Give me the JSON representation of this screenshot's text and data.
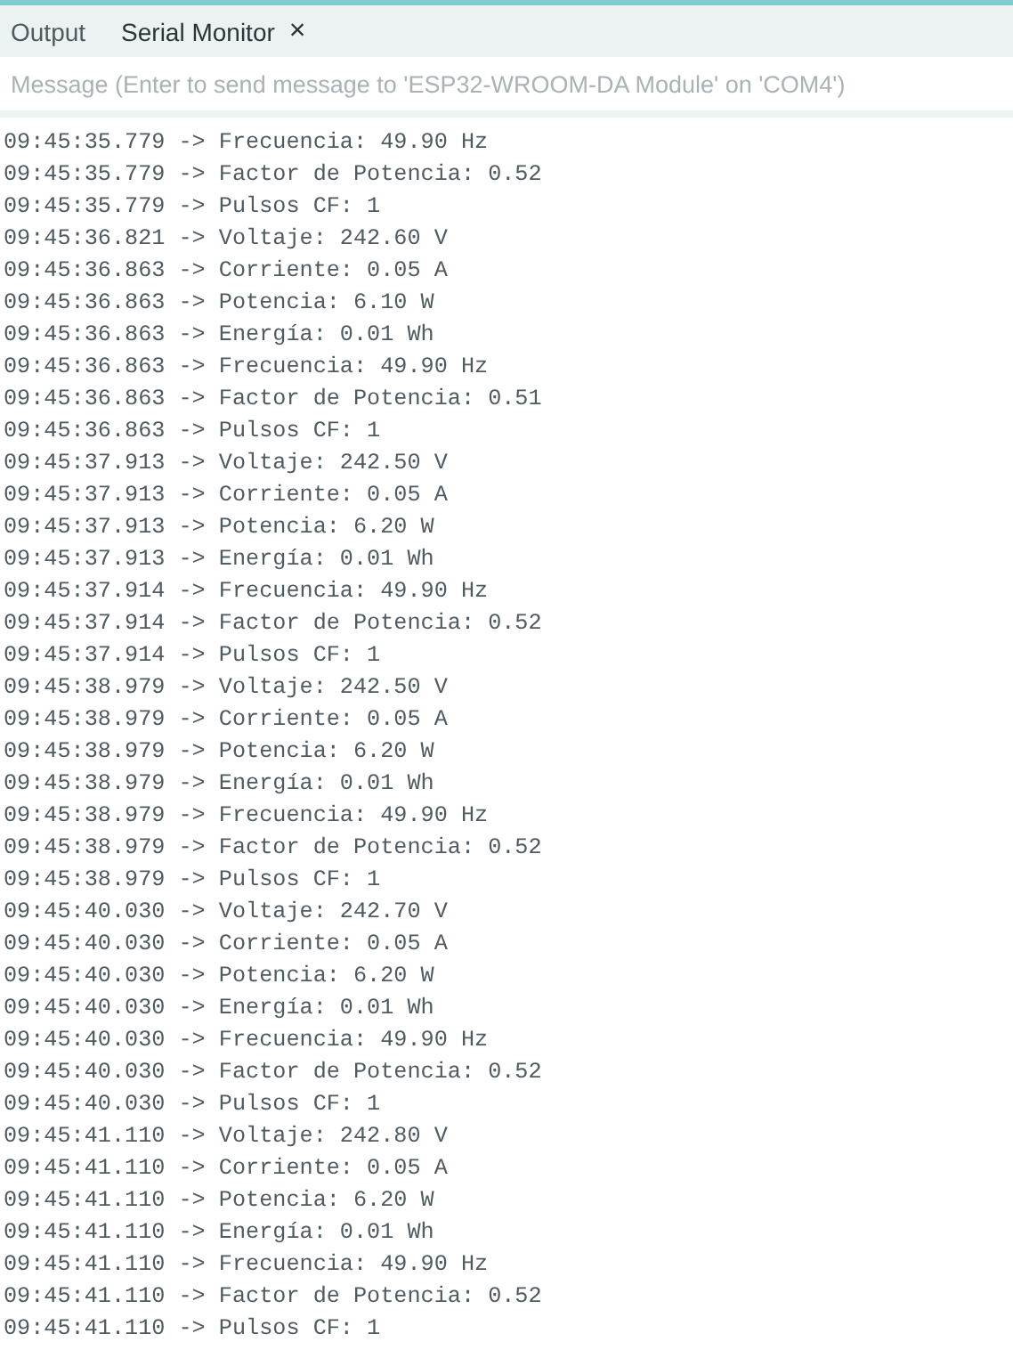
{
  "tabs": [
    {
      "label": "Output",
      "selected": false
    },
    {
      "label": "Serial Monitor",
      "selected": true,
      "close": "×"
    }
  ],
  "message_field": {
    "placeholder": "Message (Enter to send message to 'ESP32-WROOM-DA Module' on 'COM4')"
  },
  "log_lines": [
    "09:45:35.779 -> Frecuencia: 49.90 Hz",
    "09:45:35.779 -> Factor de Potencia: 0.52",
    "09:45:35.779 -> Pulsos CF: 1",
    "09:45:36.821 -> Voltaje: 242.60 V",
    "09:45:36.863 -> Corriente: 0.05 A",
    "09:45:36.863 -> Potencia: 6.10 W",
    "09:45:36.863 -> Energía: 0.01 Wh",
    "09:45:36.863 -> Frecuencia: 49.90 Hz",
    "09:45:36.863 -> Factor de Potencia: 0.51",
    "09:45:36.863 -> Pulsos CF: 1",
    "09:45:37.913 -> Voltaje: 242.50 V",
    "09:45:37.913 -> Corriente: 0.05 A",
    "09:45:37.913 -> Potencia: 6.20 W",
    "09:45:37.913 -> Energía: 0.01 Wh",
    "09:45:37.914 -> Frecuencia: 49.90 Hz",
    "09:45:37.914 -> Factor de Potencia: 0.52",
    "09:45:37.914 -> Pulsos CF: 1",
    "09:45:38.979 -> Voltaje: 242.50 V",
    "09:45:38.979 -> Corriente: 0.05 A",
    "09:45:38.979 -> Potencia: 6.20 W",
    "09:45:38.979 -> Energía: 0.01 Wh",
    "09:45:38.979 -> Frecuencia: 49.90 Hz",
    "09:45:38.979 -> Factor de Potencia: 0.52",
    "09:45:38.979 -> Pulsos CF: 1",
    "09:45:40.030 -> Voltaje: 242.70 V",
    "09:45:40.030 -> Corriente: 0.05 A",
    "09:45:40.030 -> Potencia: 6.20 W",
    "09:45:40.030 -> Energía: 0.01 Wh",
    "09:45:40.030 -> Frecuencia: 49.90 Hz",
    "09:45:40.030 -> Factor de Potencia: 0.52",
    "09:45:40.030 -> Pulsos CF: 1",
    "09:45:41.110 -> Voltaje: 242.80 V",
    "09:45:41.110 -> Corriente: 0.05 A",
    "09:45:41.110 -> Potencia: 6.20 W",
    "09:45:41.110 -> Energía: 0.01 Wh",
    "09:45:41.110 -> Frecuencia: 49.90 Hz",
    "09:45:41.110 -> Factor de Potencia: 0.52",
    "09:45:41.110 -> Pulsos CF: 1"
  ]
}
